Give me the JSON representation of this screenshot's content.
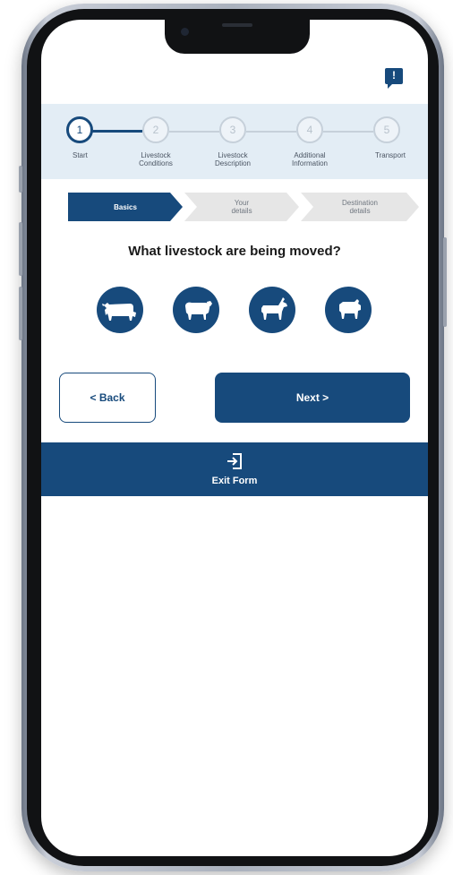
{
  "app": {
    "feedback_glyph": "!",
    "accent_color": "#174a7c"
  },
  "stepper": {
    "steps": [
      {
        "number": "1",
        "label": "Start",
        "state": "active"
      },
      {
        "number": "2",
        "label": "Livestock Conditions",
        "state": "upcoming"
      },
      {
        "number": "3",
        "label": "Livestock Description",
        "state": "upcoming"
      },
      {
        "number": "4",
        "label": "Additional Information",
        "state": "upcoming"
      },
      {
        "number": "5",
        "label": "Transport",
        "state": "upcoming"
      }
    ]
  },
  "substeps": [
    {
      "label": "Basics",
      "state": "active"
    },
    {
      "label": "Your details",
      "state": "inactive"
    },
    {
      "label": "Destination details",
      "state": "inactive"
    }
  ],
  "question": "What livestock are being moved?",
  "animals": [
    {
      "icon": "cattle-icon"
    },
    {
      "icon": "sheep-icon"
    },
    {
      "icon": "goat-icon"
    },
    {
      "icon": "pig-icon"
    }
  ],
  "nav": {
    "back_label": "< Back",
    "next_label": "Next >"
  },
  "exit": {
    "label": "Exit Form",
    "icon": "exit-icon"
  }
}
